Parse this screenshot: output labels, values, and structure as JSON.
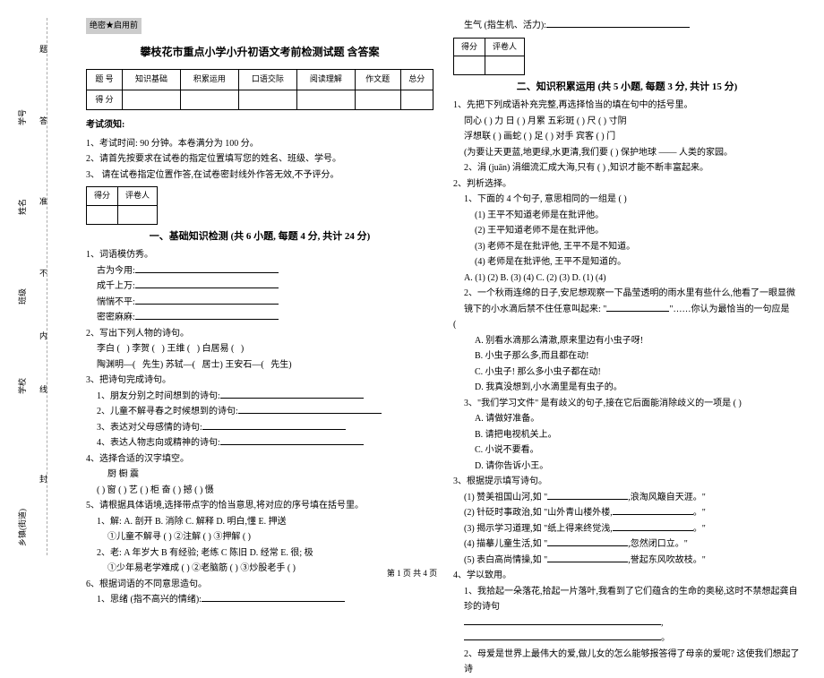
{
  "binding": {
    "labels": [
      "乡镇(街道)",
      "学校",
      "班级",
      "姓名",
      "学号"
    ],
    "seal_line": [
      "封",
      "线",
      "内",
      "不",
      "准",
      "答",
      "题"
    ]
  },
  "secret": "绝密★启用前",
  "title": "攀枝花市重点小学小升初语文考前检测试题 含答案",
  "score_table": {
    "headers": [
      "题 号",
      "知识基础",
      "积累运用",
      "口语交际",
      "阅读理解",
      "作文题",
      "总分"
    ],
    "row2": "得 分"
  },
  "notice": {
    "head": "考试须知:",
    "items": [
      "1、考试时间: 90 分钟。本卷满分为 100 分。",
      "2、请首先按要求在试卷的指定位置填写您的姓名、班级、学号。",
      "3、    请在试卷指定位置作答,在试卷密封线外作答无效,不予评分。"
    ]
  },
  "mini_score": {
    "c1": "得分",
    "c2": "评卷人"
  },
  "sec1": {
    "title": "一、基础知识检测 (共 6 小题, 每题 4 分, 共计 24 分)",
    "q1": {
      "stem": "1、词语模仿秀。",
      "lines": [
        "古为今用:",
        "成千上万:",
        "惴惴不平:",
        "密密麻麻:"
      ]
    },
    "q2": {
      "stem": "2、写出下列人物的诗句。",
      "r1": [
        "李白 (",
        "李贺 (",
        "王维 (",
        "白居易 ("
      ],
      "suffix": ")",
      "r2": [
        "陶渊明—(",
        "先生)",
        "苏轼—(",
        "居士)",
        "王安石—(",
        "先生)"
      ]
    },
    "q3": {
      "stem": "3、把诗句完成诗句。",
      "items": [
        "1、朋友分别之时间想到的诗句:",
        "2、儿童不解寻春之时候想到的诗句:",
        "3、表达对父母感情的诗句:",
        "4、表达人物志向或精神的诗句:"
      ]
    },
    "q4": {
      "stem": "4、选择合适的汉字填空。",
      "row_chars": "厨            橱            震",
      "row_paren": "(   ) 窗   (   ) 艺   (   ) 柜          奋   (   ) 撼          (   ) 慑",
      "sub": "5、请根据具体语境,选择带点字的恰当意思,将对应的序号填在括号里。",
      "i1": "1、解:   A. 剖开   B. 消除   C. 解释   D. 明白,懂   E. 押送",
      "i1a": "①儿童不解寻   (   )   ②注解   (   )   ③押解   (   )",
      "i2": "2、老:   A 年岁大   B 有经验; 老练   C 陈旧   D. 经常   E. 很; 极",
      "i2a": "①少年易老学难成   (   )   ②老脑筋   (   )   ③炒股老手   (   )"
    },
    "q5": {
      "stem": "6、根据词语的不同意思造句。",
      "line": "1、思绪 (指不高兴的情绪):"
    }
  },
  "right": {
    "top_line": "生气 (指生机、活力):",
    "sec2_title": "二、知识积累运用 (共 5 小题, 每题 3 分, 共计 15 分)",
    "q1": {
      "stem": "1、先把下列成语补充完整,再选择恰当的填在句中的括号里。",
      "rows": [
        "同心 (   ) 力    日 (   ) 月累    五彩斑 (   )    尺 (   ) 寸阴",
        "浮想联 (   )     画蛇 (   ) 足    (   ) 对手     宾客 (   ) 门",
        "(为要让天更蓝,地更绿,水更清,我们要 (          ) 保护地球 —— 人类的家园。",
        "2、涓 (juān) 涓细流汇成大海,只有 (          ) ,知识才能不断丰富起来。"
      ]
    },
    "q2": {
      "stem": "2、判析选择。",
      "sub": "1、下面的 4 个句子, 意思相同的一组是 (   )",
      "opts": [
        "(1) 王平不知道老师是在批评他。",
        "(2) 王平知道老师不是在批评他。",
        "(3) 老师不是在批评他, 王平不是不知道。",
        "(4) 老师是在批评他, 王平不是知道的。"
      ],
      "ans": "A. (1) (2)     B. (3) (4)     C. (2) (3)     D. (1) (4)",
      "sub2": "2、一个秋雨连绵的日子,安尼想观察一下晶莹透明的雨水里有些什么,他看了一眼显微镜下的小水滴后禁不住任意叫起来:  \"",
      "sub2_tail": "\"……你认为最恰当的一句应是",
      "sub2_paren": "(",
      "opts2": [
        "A. 别看水滴那么清澈,原来里边有小虫子呀!",
        "B. 小虫子那么多,而且都在动!",
        "C. 小虫子! 那么多小虫子都在动!",
        "D. 我真没想到,小水滴里是有虫子的。"
      ],
      "sub3": "3、\"我们学习文件\" 是有歧义的句子,接在它后面能消除歧义的一项是 (   )",
      "opts3": [
        "A. 请做好准备。",
        "B. 请把电视机关上。",
        "C. 小说不要看。",
        "D. 请你告诉小王。"
      ]
    },
    "q3": {
      "stem": "3、根据提示填写诗句。",
      "items": [
        "(1) 赞美祖国山河,如 \"",
        "(2) 针砭时事政治,如 \"山外青山楼外楼,",
        "(3) 揭示学习道理,如 \"纸上得来终觉浅,",
        "(4) 描摹儿童生活,如 \"",
        "(5) 表白高尚情操,如 \""
      ],
      "tails": [
        ",浪淘风簸自天涯。\"",
        "。\"",
        "。\"",
        ",忽然闭口立。\"",
        ",誉起东风吹故枝。\""
      ]
    },
    "q4": {
      "stem": "4、学以致用。",
      "lines": [
        "1、我拾起一朵落花,拾起一片落叶,我看到了它们蕴含的生命的奥秘,这时不禁想起龚自珍的诗句",
        "2、母爱是世界上最伟大的爱,做儿女的怎么能够报答得了母亲的爱呢? 这使我们想起了诗"
      ]
    }
  },
  "footer": "第 1 页 共 4 页"
}
